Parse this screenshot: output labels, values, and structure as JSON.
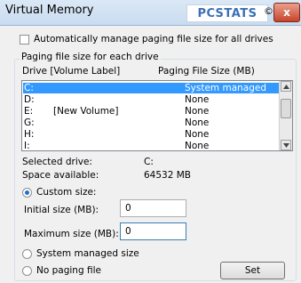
{
  "window": {
    "title": "Virtual Memory",
    "close_glyph": "x",
    "copyright_glyph": "©"
  },
  "logo": {
    "part1": "PC",
    "part2": "STATS"
  },
  "auto_manage": {
    "label": "Automatically manage paging file size for all drives",
    "checked": false
  },
  "group": {
    "legend": "Paging file size for each drive",
    "headers": {
      "drive": "Drive  [Volume Label]",
      "size": "Paging File Size (MB)"
    },
    "drives": [
      {
        "drive": "C:",
        "label": "",
        "size": "System managed",
        "selected": true
      },
      {
        "drive": "D:",
        "label": "",
        "size": "None",
        "selected": false
      },
      {
        "drive": "E:",
        "label": "[New Volume]",
        "size": "None",
        "selected": false
      },
      {
        "drive": "G:",
        "label": "",
        "size": "None",
        "selected": false
      },
      {
        "drive": "H:",
        "label": "",
        "size": "None",
        "selected": false
      },
      {
        "drive": "I:",
        "label": "",
        "size": "None",
        "selected": false
      }
    ]
  },
  "info": {
    "selected_drive_label": "Selected drive:",
    "selected_drive_value": "C:",
    "space_label": "Space available:",
    "space_value": "64532 MB"
  },
  "custom_size": {
    "label": "Custom size:",
    "checked": true
  },
  "initial_size": {
    "label": "Initial size (MB):",
    "value": "0"
  },
  "maximum_size": {
    "label": "Maximum size (MB):",
    "value": "0"
  },
  "system_managed": {
    "label": "System managed size",
    "checked": false
  },
  "no_paging": {
    "label": "No paging file",
    "checked": false
  },
  "set_button": {
    "label": "Set"
  }
}
